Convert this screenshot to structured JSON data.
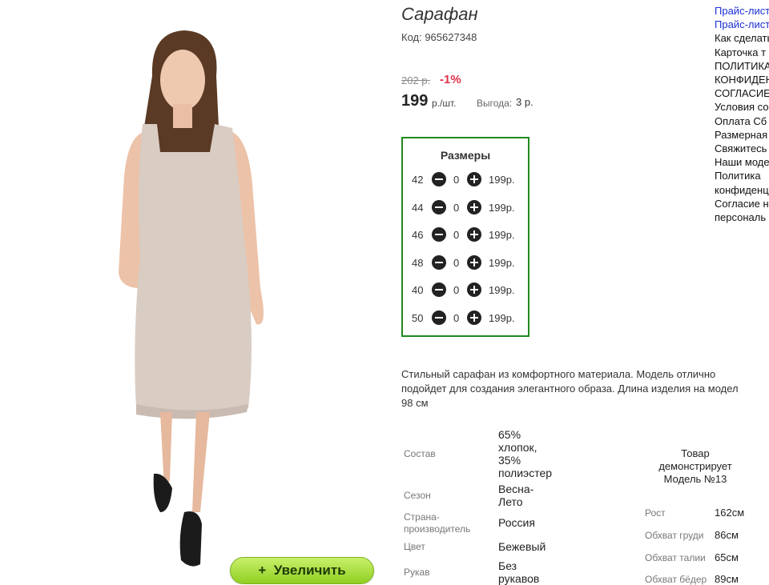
{
  "photo": {
    "zoom_label": "Увеличить",
    "zoom_icon": "+"
  },
  "product": {
    "title": "Сарафан",
    "code": "Код: 965627348",
    "old_price": "202 р.",
    "discount": "-1%",
    "price": "199",
    "price_unit": "р./шт.",
    "benefit_label": "Выгода:",
    "benefit_value": "3 р."
  },
  "sizes": {
    "title": "Размеры",
    "rows": [
      {
        "size": "42",
        "qty": "0",
        "price": "199р."
      },
      {
        "size": "44",
        "qty": "0",
        "price": "199р."
      },
      {
        "size": "46",
        "qty": "0",
        "price": "199р."
      },
      {
        "size": "48",
        "qty": "0",
        "price": "199р."
      },
      {
        "size": "40",
        "qty": "0",
        "price": "199р."
      },
      {
        "size": "50",
        "qty": "0",
        "price": "199р."
      }
    ]
  },
  "description": {
    "line1": "Стильный сарафан из комфортного материала. Модель отлично",
    "line2": "подойдет для создания элегантного образа. Длина изделия на модел",
    "line3": "98 см"
  },
  "attributes": [
    {
      "label": "Состав",
      "value_lines": [
        "65%",
        "хлопок,",
        "35%",
        "полиэстер"
      ]
    },
    {
      "label": "Сезон",
      "value_lines": [
        "Весна-",
        "Лето"
      ]
    },
    {
      "label_lines": [
        "Страна-",
        "производитель"
      ],
      "value_lines": [
        "Россия"
      ]
    },
    {
      "label": "Цвет",
      "value_lines": [
        "Бежевый"
      ]
    },
    {
      "label": "Рукав",
      "value_lines": [
        "Без",
        "рукавов"
      ]
    }
  ],
  "model": {
    "title_lines": [
      "Товар",
      "демонстрирует",
      "Модель №13"
    ],
    "measurements": [
      {
        "label": "Рост",
        "value": "162см"
      },
      {
        "label": "Обхват груди",
        "value": "86см"
      },
      {
        "label": "Обхват талии",
        "value": "65см"
      },
      {
        "label": "Обхват бёдер",
        "value": "89см"
      }
    ]
  },
  "right_links": [
    {
      "text": "Прайс-лист",
      "style": "link"
    },
    {
      "text": "Прайс-лист",
      "style": "link"
    },
    {
      "text": "Как сделать",
      "style": "plain"
    },
    {
      "text": "Карточка т",
      "style": "plain"
    },
    {
      "text": "ПОЛИТИКА",
      "style": "plain"
    },
    {
      "text": "КОНФИДЕН",
      "style": "plain"
    },
    {
      "text": "СОГЛАСИЕ",
      "style": "plain"
    },
    {
      "text": "Условия со",
      "style": "plain"
    },
    {
      "text": "Оплата Сб",
      "style": "plain"
    },
    {
      "text": "Размерная",
      "style": "plain"
    },
    {
      "text": "Свяжитесь",
      "style": "plain"
    },
    {
      "text": "Наши моде",
      "style": "plain"
    },
    {
      "text": "Политика",
      "style": "plain"
    },
    {
      "text": "конфиденц",
      "style": "plain"
    },
    {
      "text": "Согласие н",
      "style": "plain"
    },
    {
      "text": "персональ",
      "style": "plain"
    }
  ],
  "colors": {
    "accent_green": "#1f8a1f",
    "discount_red": "#e0324b",
    "link_blue": "#1a2fd6",
    "zoom_button": "#a6e03a"
  }
}
